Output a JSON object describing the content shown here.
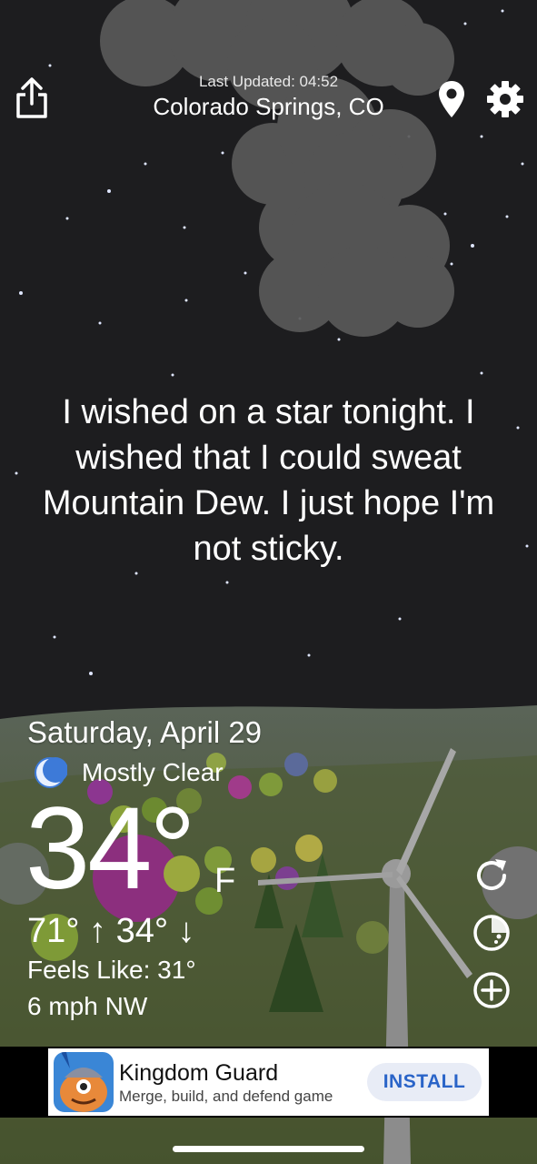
{
  "header": {
    "last_updated": "Last Updated: 04:52",
    "location": "Colorado Springs, CO",
    "share_icon": "share-icon",
    "location_icon": "map-pin-icon",
    "settings_icon": "gear-icon"
  },
  "joke": "I wished on a star tonight. I wished that I could sweat Mountain Dew. I just hope I'm not sticky.",
  "weather": {
    "date": "Saturday, April 29",
    "condition_icon": "moon-icon",
    "condition": "Mostly Clear",
    "temperature": "34°",
    "unit": "F",
    "high_low": "71° ↑ 34° ↓",
    "feels_like": "Feels Like: 31°",
    "wind": "6 mph NW"
  },
  "actions": {
    "refresh_icon": "refresh-icon",
    "radar_icon": "radar-icon",
    "add_icon": "add-circle-icon"
  },
  "ad": {
    "title": "Kingdom Guard",
    "subtitle": "Merge, build, and defend game",
    "install_label": "INSTALL"
  },
  "colors": {
    "sky": "#1d1d1f",
    "hills": "#4c5a3c",
    "cloud": "#5b5b5b",
    "install_text": "#2a64c8"
  }
}
